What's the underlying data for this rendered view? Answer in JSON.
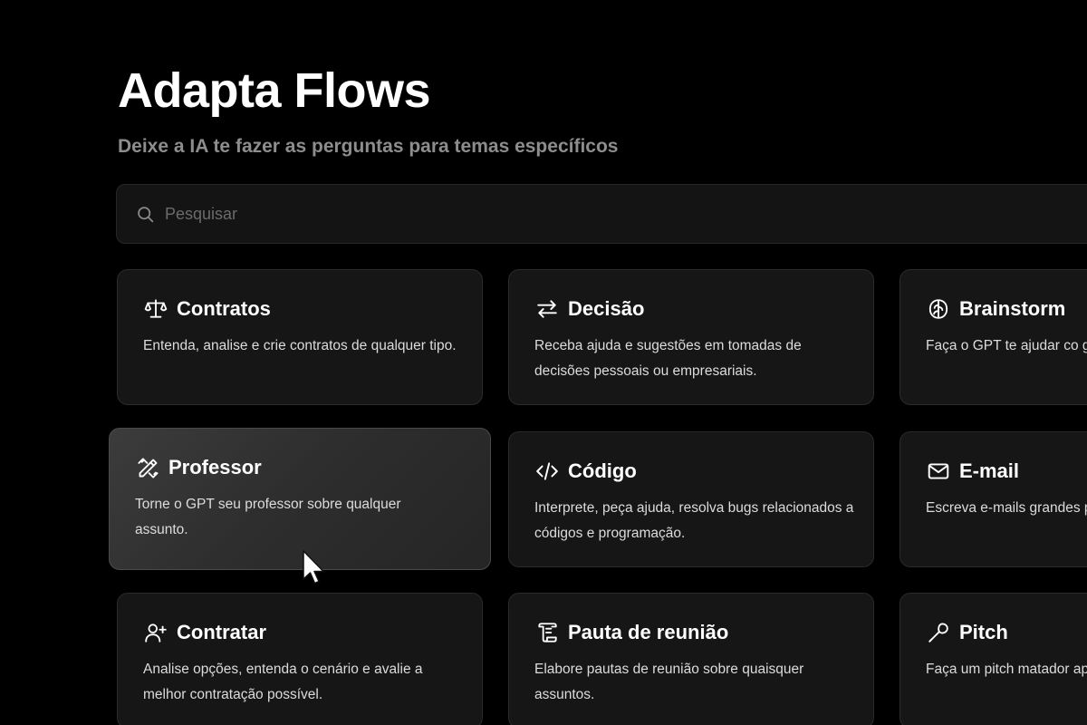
{
  "header": {
    "title": "Adapta Flows",
    "subtitle": "Deixe a IA te fazer as perguntas para temas específicos"
  },
  "search": {
    "placeholder": "Pesquisar",
    "icon": "search-icon"
  },
  "cards": [
    {
      "id": "contratos",
      "icon": "scale-icon",
      "title": "Contratos",
      "description": "Entenda, analise e crie contratos de qualquer tipo."
    },
    {
      "id": "decisao",
      "icon": "swap-arrows-icon",
      "title": "Decisão",
      "description": "Receba ajuda e sugestões em tomadas de decisões pessoais ou empresariais."
    },
    {
      "id": "brainstorm",
      "icon": "brain-icon",
      "title": "Brainstorm",
      "description": "Faça o GPT te ajudar co geração de ideias."
    },
    {
      "id": "professor",
      "icon": "pencil-ruler-icon",
      "title": "Professor",
      "description": "Torne o GPT seu professor sobre qualquer assunto.",
      "hovered": true
    },
    {
      "id": "codigo",
      "icon": "code-icon",
      "title": "Código",
      "description": "Interprete, peça ajuda, resolva bugs relacionados a códigos e programação."
    },
    {
      "id": "email",
      "icon": "mail-icon",
      "title": "E-mail",
      "description": "Escreva e-mails grandes poucos inputs."
    },
    {
      "id": "contratar",
      "icon": "user-plus-icon",
      "title": "Contratar",
      "description": "Analise opções, entenda o cenário e avalie a melhor contratação possível."
    },
    {
      "id": "pauta",
      "icon": "scroll-icon",
      "title": "Pauta de reunião",
      "description": "Elabore pautas de reunião sobre quaisquer assuntos."
    },
    {
      "id": "pitch",
      "icon": "wrench-icon",
      "title": "Pitch",
      "description": "Faça um pitch matador apresentar uma ideia."
    }
  ]
}
